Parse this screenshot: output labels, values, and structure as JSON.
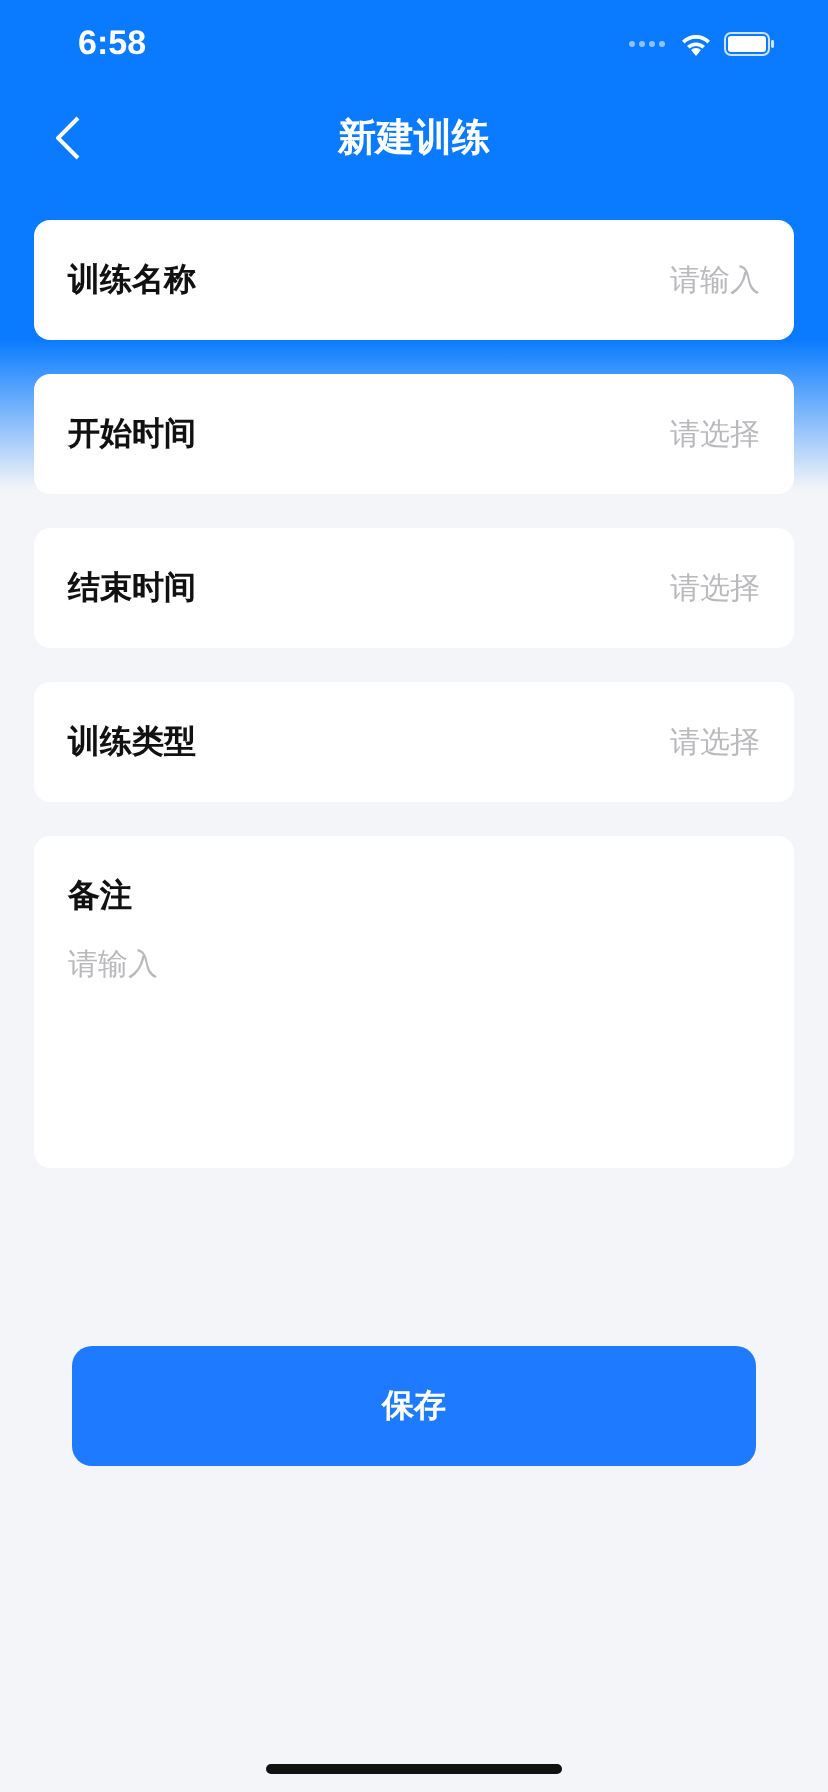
{
  "status_bar": {
    "time": "6:58"
  },
  "nav": {
    "title": "新建训练"
  },
  "fields": [
    {
      "label": "训练名称",
      "placeholder": "请输入"
    },
    {
      "label": "开始时间",
      "placeholder": "请选择"
    },
    {
      "label": "结束时间",
      "placeholder": "请选择"
    },
    {
      "label": "训练类型",
      "placeholder": "请选择"
    }
  ],
  "notes": {
    "label": "备注",
    "placeholder": "请输入"
  },
  "save_button": "保存"
}
